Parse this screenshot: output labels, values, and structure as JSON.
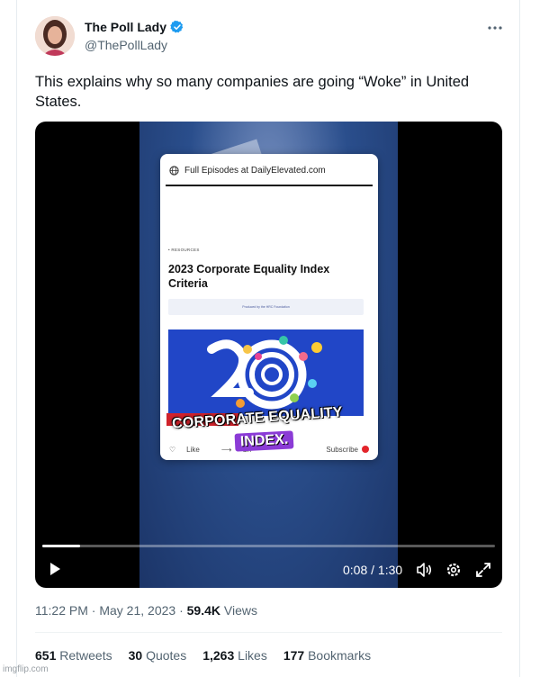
{
  "author": {
    "name": "The Poll Lady",
    "handle": "@ThePollLady",
    "verified_color": "#1d9bf0"
  },
  "tweet": {
    "text": "This explains why so many companies are going “Woke” in United States."
  },
  "video": {
    "card_header": "Full Episodes at DailyElevated.com",
    "card_section": "• RESOURCES",
    "card_title": "2023 Corporate Equality Index Criteria",
    "card_strip": "Produced by the HRC Foundation",
    "card_like": "Like",
    "card_share": "Sh",
    "card_subscribe": "Subscribe",
    "caption_line1": "CORPORATE EQUALITY",
    "caption_line2": "INDEX.",
    "time": "0:08 / 1:30",
    "progress_fraction": 0.083
  },
  "meta": {
    "time": "11:22 PM",
    "date": "May 21, 2023",
    "views_count": "59.4K",
    "views_label": "Views"
  },
  "stats": [
    {
      "count": "651",
      "label": "Retweets"
    },
    {
      "count": "30",
      "label": "Quotes"
    },
    {
      "count": "1,263",
      "label": "Likes"
    },
    {
      "count": "177",
      "label": "Bookmarks"
    }
  ],
  "watermark": "imgflip.com",
  "icons": [
    "verified-icon",
    "more-icon",
    "globe-icon",
    "heart-icon",
    "share-icon",
    "play-icon",
    "volume-icon",
    "settings-icon",
    "fullscreen-icon"
  ]
}
